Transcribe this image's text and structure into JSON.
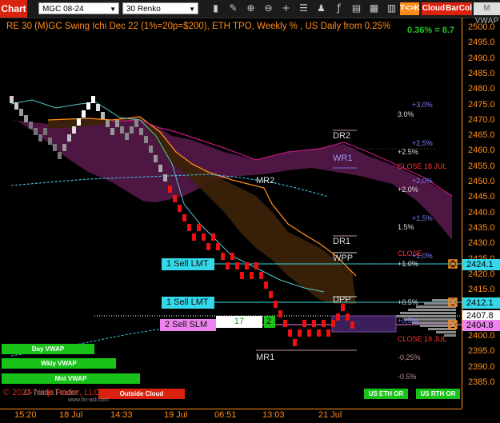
{
  "toolbar": {
    "chart_tab": "Chart",
    "instrument": "MGC 08-24",
    "bar_type": "30 Renko",
    "tk_button": "T<>K",
    "cloud_button": "Cloud",
    "barcol_button": "BarCol",
    "mvwap_button": "M VWAP",
    "icons": [
      "bar-style-icon",
      "draw-tool-icon",
      "zoom-in-icon",
      "zoom-out-icon",
      "crosshair-icon",
      "properties-icon",
      "strategies-icon",
      "indicators-icon",
      "templates-icon",
      "data-box-icon",
      "chart-trader-icon",
      "layout-icon"
    ]
  },
  "chart": {
    "title": "RE 30 (M)GC Swing Ichi Dec 22 (1%=20p=$200), ETH TPO, Weekly % , US Daily from 0.25%",
    "pct_readout": "0.36% = 8.7",
    "copyright": "© 2024 NinjaTrader, LLC",
    "watermark": "C-Trade Finder",
    "watermark_url": "www.fin-aid.com"
  },
  "price_axis": {
    "ticks": [
      "2500.0",
      "2495.0",
      "2490.0",
      "2485.0",
      "2480.0",
      "2475.0",
      "2470.0",
      "2465.0",
      "2460.0",
      "2455.0",
      "2450.0",
      "2445.0",
      "2440.0",
      "2435.0",
      "2430.0",
      "2425.0",
      "2420.0",
      "2415.0",
      "2410.0",
      "2405.0",
      "2400.0",
      "2395.0",
      "2390.0",
      "2385.0"
    ],
    "tags": [
      {
        "label": "2424.1",
        "color": "#35d8e8"
      },
      {
        "label": "2412.1",
        "color": "#35d8e8"
      },
      {
        "label": "2407.8",
        "color": "#ffffff"
      },
      {
        "label": "2404.8",
        "color": "#ee82ee"
      }
    ]
  },
  "time_axis": [
    "15:20",
    "18 Jul",
    "14:33",
    "19 Jul",
    "06:51",
    "13:03",
    "21 Jul"
  ],
  "levels": {
    "dr2": "DR2",
    "wr1": "WR1",
    "mr2": "MR2",
    "dr1": "DR1",
    "wpp": "WPP",
    "dpp": "DPP",
    "mr1": "MR1",
    "close18": "CLOSE 18 JUL",
    "close19": "CLOSE 19 JUL",
    "close_partial": "CLOSE",
    "pct": [
      "+3,0%",
      "3.0%",
      "+2,5%",
      "+2.5%",
      "+2,0%",
      "+2.0%",
      "+1,5%",
      "1.5%",
      "+1,0%",
      "+1.0%",
      "+0.5%",
      "+0,5%",
      "-0,25%",
      "-0.5%"
    ]
  },
  "tags": {
    "sell1": "1 Sell LMT",
    "sell2": "1 Sell LMT",
    "sell3": "2 Sell SLM",
    "qty": "17",
    "pos": "2"
  },
  "vwap": {
    "day": "Day VWAP",
    "wkly": "Wkly VWAP",
    "mnt": "Mnt VWAP",
    "outside": "Outside Cloud",
    "us_eth": "US ETH OR",
    "us_rth": "US RTH OR"
  }
}
